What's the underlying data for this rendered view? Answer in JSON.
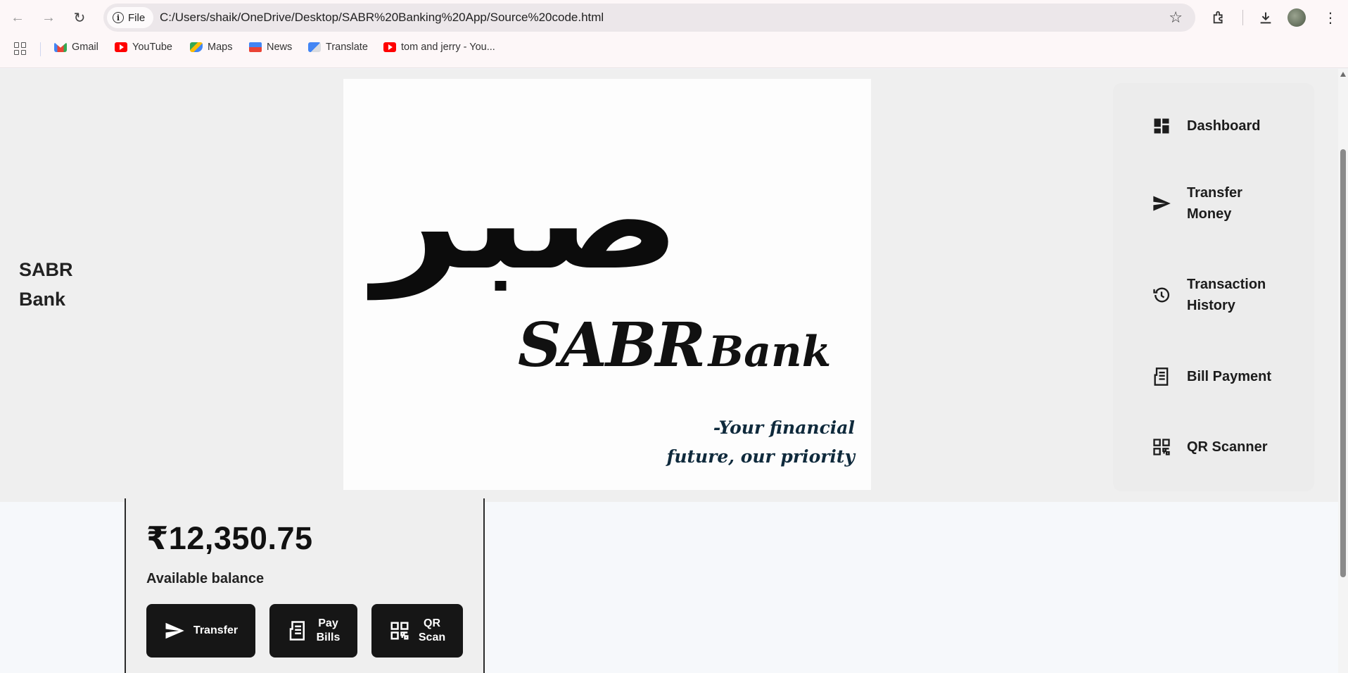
{
  "browser": {
    "file_chip": "File",
    "url": "C:/Users/shaik/OneDrive/Desktop/SABR%20Banking%20App/Source%20code.html",
    "bookmarks": [
      {
        "label": "Gmail",
        "icon": "gmail-icon"
      },
      {
        "label": "YouTube",
        "icon": "youtube-icon"
      },
      {
        "label": "Maps",
        "icon": "maps-icon"
      },
      {
        "label": "News",
        "icon": "news-icon"
      },
      {
        "label": "Translate",
        "icon": "translate-icon"
      },
      {
        "label": "tom and jerry - You...",
        "icon": "youtube-icon"
      }
    ]
  },
  "header": {
    "brand_line1": "SABR",
    "brand_line2": "Bank"
  },
  "logo": {
    "arabic": "صبر",
    "title_main": "SABR",
    "title_sub": "Bank",
    "tagline_line1": "-Your financial",
    "tagline_line2": "future, our priority"
  },
  "nav": {
    "items": [
      {
        "label_line1": "Dashboard",
        "label_line2": "",
        "icon": "dashboard-icon"
      },
      {
        "label_line1": "Transfer",
        "label_line2": "Money",
        "icon": "send-icon"
      },
      {
        "label_line1": "Transaction",
        "label_line2": "History",
        "icon": "history-icon"
      },
      {
        "label_line1": "Bill Payment",
        "label_line2": "",
        "icon": "receipt-icon"
      },
      {
        "label_line1": "QR Scanner",
        "label_line2": "",
        "icon": "qr-icon"
      }
    ]
  },
  "balance": {
    "amount": "₹12,350.75",
    "label": "Available balance",
    "actions": [
      {
        "line1": "Transfer",
        "line2": "",
        "icon": "send-icon"
      },
      {
        "line1": "Pay",
        "line2": "Bills",
        "icon": "receipt-icon"
      },
      {
        "line1": "QR",
        "line2": "Scan",
        "icon": "qr-icon"
      }
    ]
  },
  "colors": {
    "accent": "#161616",
    "hero_bg": "#efefef",
    "page_bg": "#f6f8fb"
  }
}
